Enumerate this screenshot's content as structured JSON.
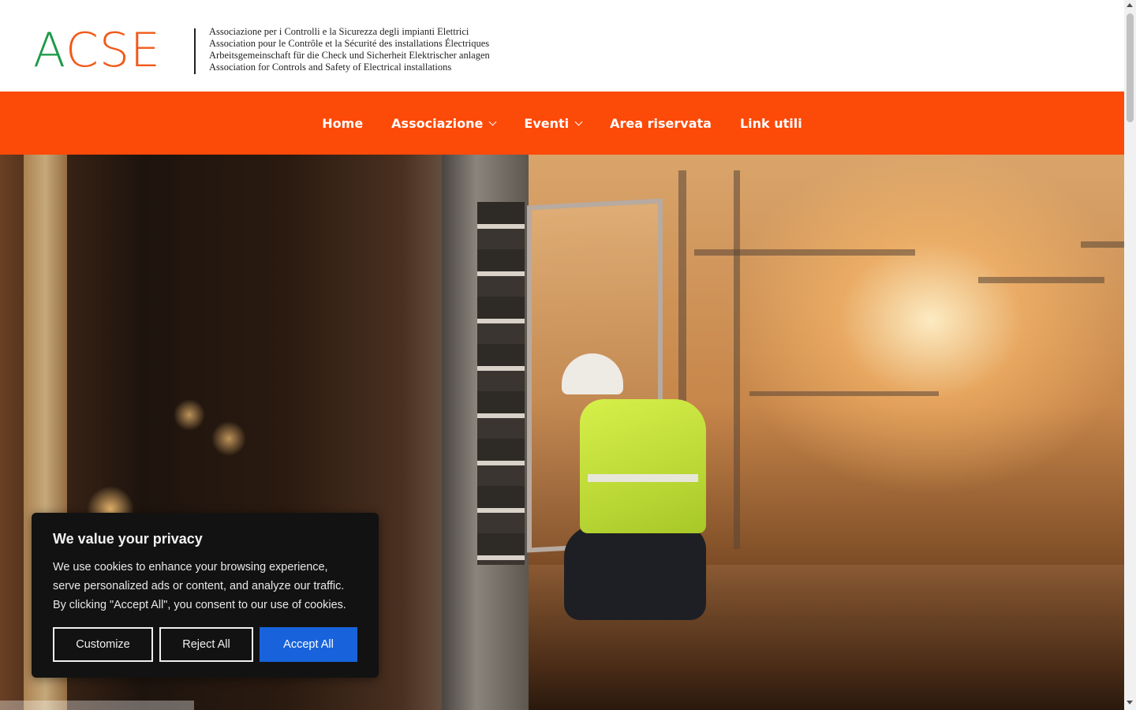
{
  "brand": {
    "logo_letters": [
      "A",
      "C",
      "S",
      "E"
    ],
    "tagline_lines": [
      "Associazione per i Controlli e la Sicurezza degli impianti Elettrici",
      "Association pour le Contrôle et la Sécurité des installations Électriques",
      "Arbeitsgemeinschaft für die Check und Sicherheit Elektrischer anlagen",
      "Association for Controls and Safety of Electrical installations"
    ],
    "colors": {
      "green": "#1f9a4a",
      "orange": "#f05a1a"
    }
  },
  "nav": {
    "background": "#fc4a09",
    "items": [
      {
        "label": "Home",
        "has_dropdown": false
      },
      {
        "label": "Associazione",
        "has_dropdown": true
      },
      {
        "label": "Eventi",
        "has_dropdown": true
      },
      {
        "label": "Area riservata",
        "has_dropdown": false
      },
      {
        "label": "Link utili",
        "has_dropdown": false
      }
    ]
  },
  "hero": {
    "image_description_icon": "hero-photo-electrician-icon"
  },
  "cookie_banner": {
    "title": "We value your privacy",
    "text": "We use cookies to enhance your browsing experience, serve personalized ads or content, and analyze our traffic. By clicking \"Accept All\", you consent to our use of cookies.",
    "buttons": {
      "customize": "Customize",
      "reject": "Reject All",
      "accept": "Accept All"
    },
    "accent": "#1863dc"
  }
}
